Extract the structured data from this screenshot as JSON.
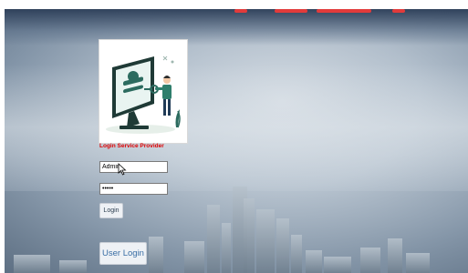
{
  "login_form": {
    "service_label": "Login Service Provider",
    "username_value": "Admin",
    "password_value": "•••••",
    "login_button": "Login"
  },
  "user_login_button": "User Login",
  "colors": {
    "label_red": "#e00000",
    "button_bg": "#eef1f5",
    "sky_dark": "#2c3e58"
  },
  "icons": [
    "login-illustration-icon",
    "mouse-cursor-icon"
  ]
}
